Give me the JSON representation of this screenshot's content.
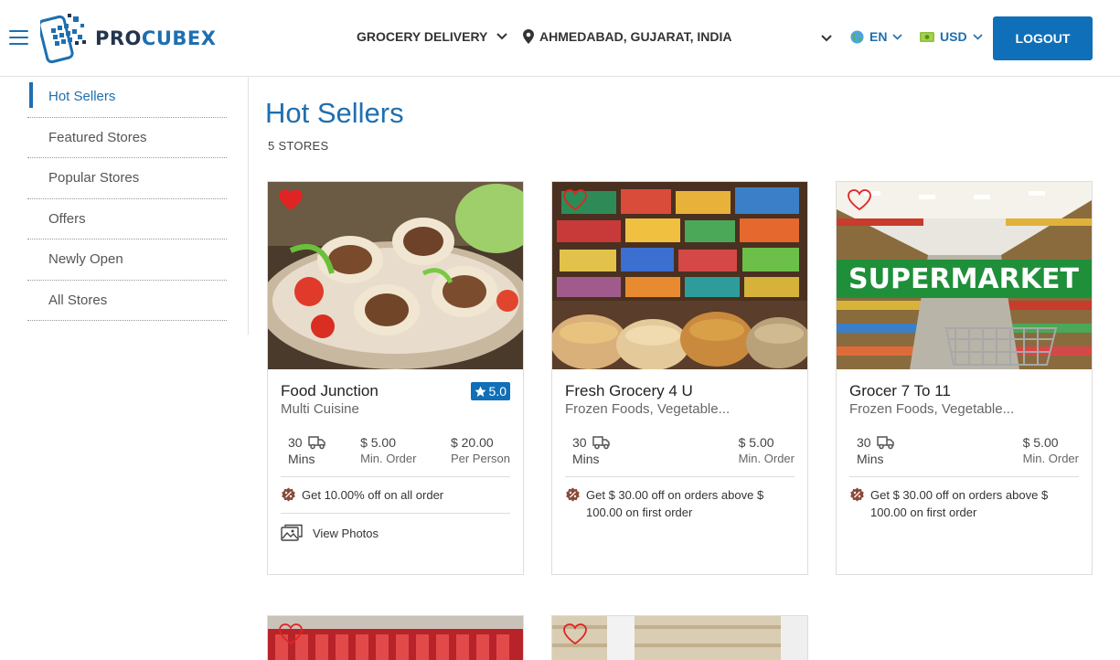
{
  "header": {
    "logo_pro": "PRO",
    "logo_cubex": "CUBEX",
    "delivery_label": "GROCERY DELIVERY",
    "location": "AHMEDABAD, GUJARAT, INDIA",
    "language": "EN",
    "currency": "USD",
    "logout_label": "LOGOUT"
  },
  "sidebar": {
    "items": [
      {
        "label": "Hot Sellers",
        "active": true
      },
      {
        "label": "Featured Stores"
      },
      {
        "label": "Popular Stores"
      },
      {
        "label": "Offers"
      },
      {
        "label": "Newly Open"
      },
      {
        "label": "All Stores"
      }
    ]
  },
  "main": {
    "title": "Hot Sellers",
    "count": "5 STORES",
    "stores": [
      {
        "name": "Food Junction",
        "category": "Multi Cuisine",
        "rating": "5.0",
        "time": "30",
        "time_unit": "Mins",
        "min_order": "$ 5.00",
        "min_order_label": "Min. Order",
        "per_person": "$ 20.00",
        "per_person_label": "Per Person",
        "offer": "Get 10.00% off on all order",
        "photos_label": "View Photos",
        "favorited": true
      },
      {
        "name": "Fresh Grocery 4 U",
        "category": "Frozen Foods, Vegetable...",
        "time": "30",
        "time_unit": "Mins",
        "min_order": "$ 5.00",
        "min_order_label": "Min. Order",
        "offer": "Get $ 30.00 off on orders above $ 100.00 on first order",
        "favorited": false
      },
      {
        "name": "Grocer 7 To 11",
        "category": "Frozen Foods, Vegetable...",
        "image_text": "SUPERMARKET",
        "time": "30",
        "time_unit": "Mins",
        "min_order": "$ 5.00",
        "min_order_label": "Min. Order",
        "offer": "Get $ 30.00 off on orders above $ 100.00 on first order",
        "favorited": false
      }
    ]
  },
  "colors": {
    "brand": "#1e6fb0",
    "button": "#0f6fb8",
    "heart": "#e02424"
  }
}
